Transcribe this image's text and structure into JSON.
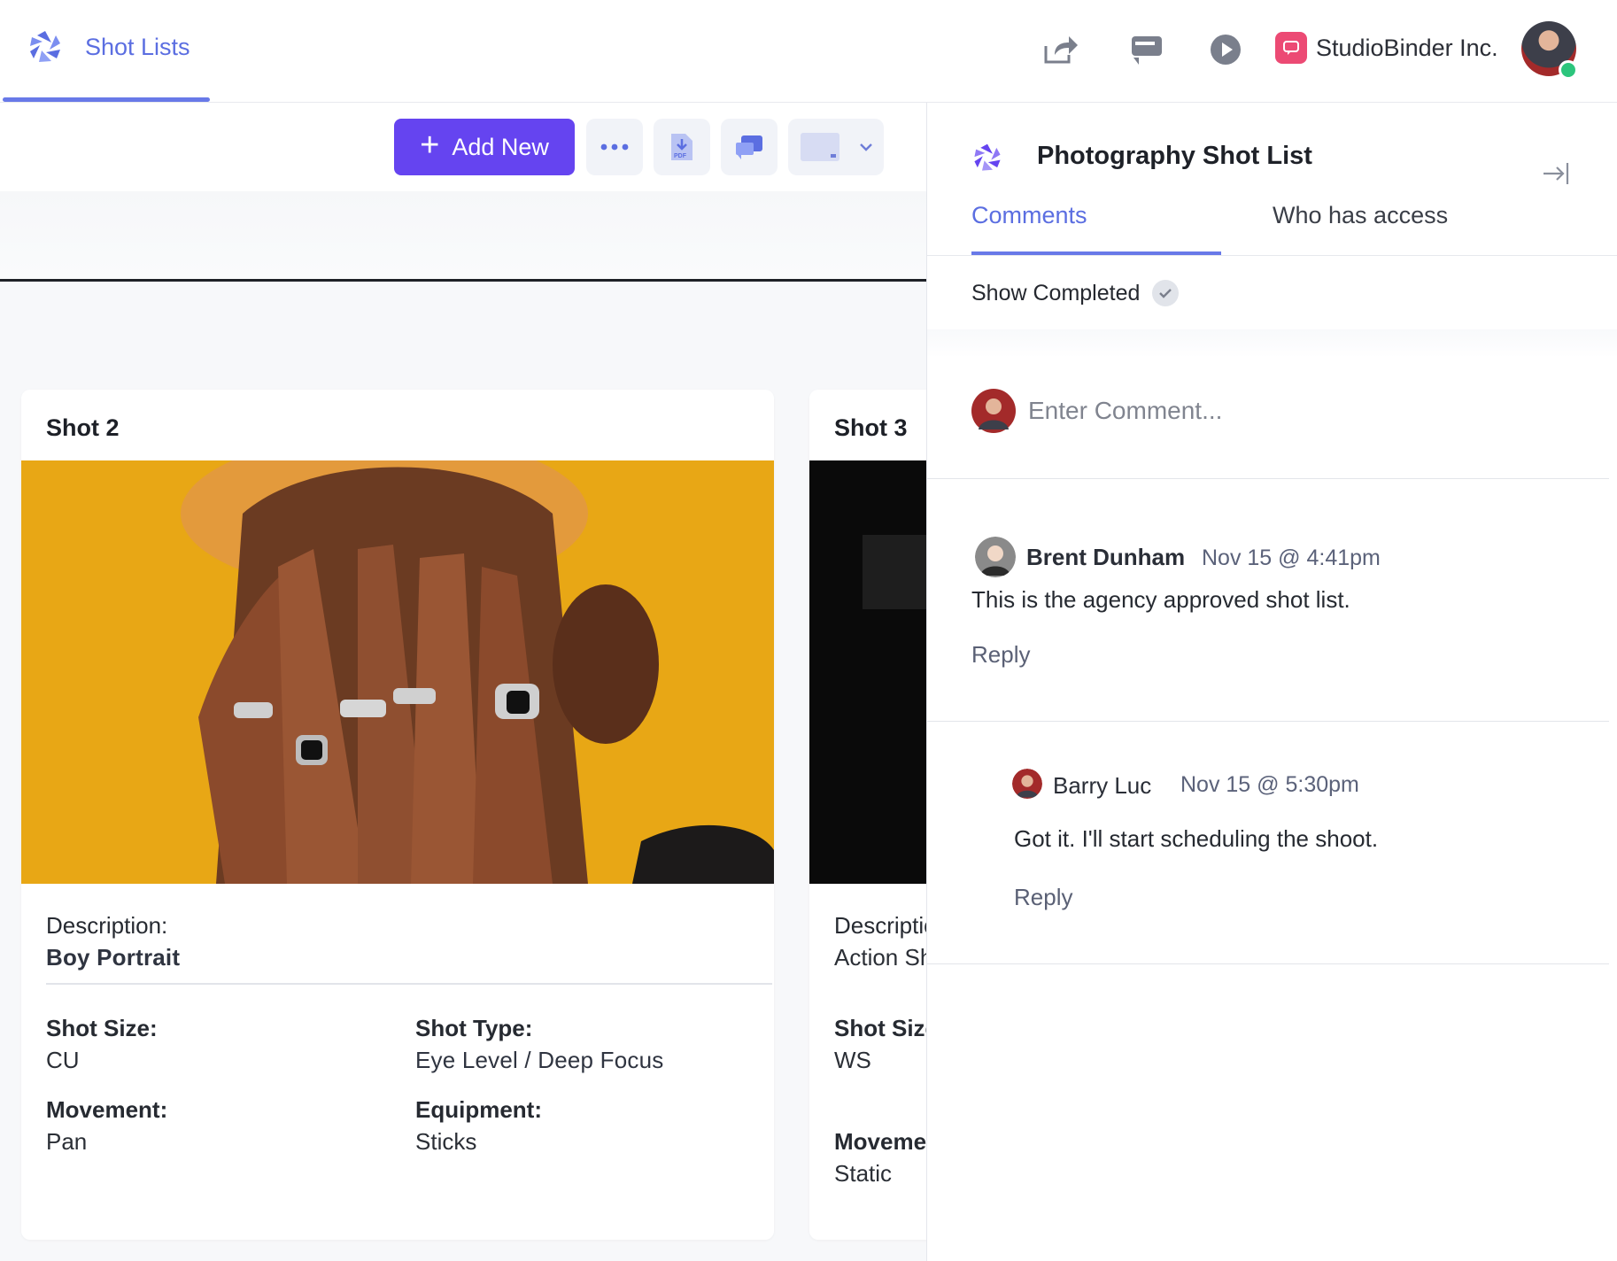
{
  "app": {
    "section_title": "Shot Lists",
    "company_name": "StudioBinder Inc."
  },
  "toolbar": {
    "add_new_label": "Add New"
  },
  "shots": [
    {
      "title": "Shot  2",
      "description_label": "Description:",
      "description": "Boy Portrait",
      "shot_size_label": "Shot Size:",
      "shot_size": "CU",
      "shot_type_label": "Shot Type:",
      "shot_type": "Eye Level / Deep Focus",
      "movement_label": "Movement:",
      "movement": "Pan",
      "equipment_label": "Equipment:",
      "equipment": "Sticks"
    },
    {
      "title": "Shot  3",
      "description_label": "Description:",
      "description": "Action Shot",
      "shot_size_label": "Shot Size:",
      "shot_size": "WS",
      "movement_label": "Movement:",
      "movement": "Static"
    }
  ],
  "panel": {
    "title": "Photography Shot List",
    "tabs": [
      "Comments",
      "Who has access"
    ],
    "show_completed_label": "Show Completed",
    "comment_placeholder": "Enter Comment...",
    "comments": [
      {
        "author": "Brent Dunham",
        "time": "Nov 15 @ 4:41pm",
        "text": "This is the agency approved shot list.",
        "reply_label": "Reply"
      },
      {
        "author": "Barry Luc",
        "time": "Nov 15 @ 5:30pm",
        "text": "Got it. I'll start scheduling the shoot.",
        "reply_label": "Reply"
      }
    ]
  },
  "colors": {
    "accent": "#5b6ee1",
    "primary_button": "#6544f0",
    "badge": "#ec4a74",
    "online": "#2cc57c",
    "photo_background": "#e8a715"
  }
}
